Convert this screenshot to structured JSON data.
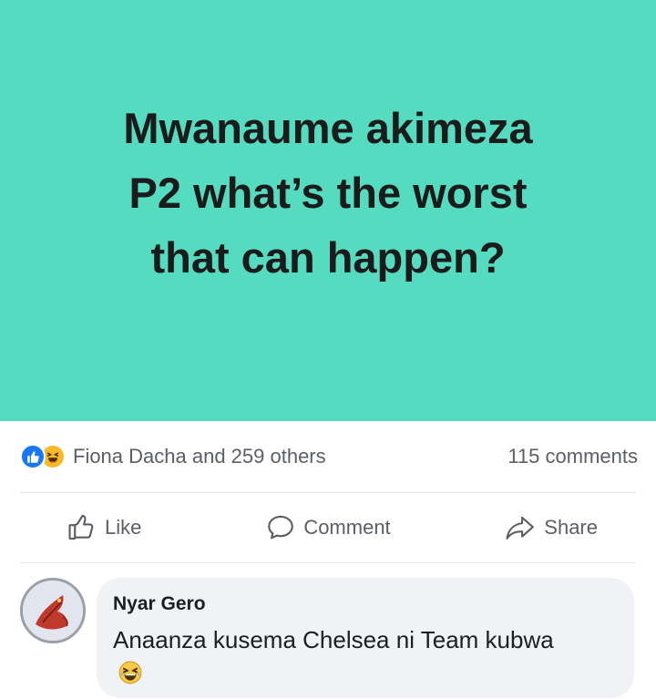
{
  "post": {
    "card_text": "Mwanaume akimeza\nP2 what’s the worst\nthat can happen?",
    "card_bg_color": "#55dcc0",
    "reactions": {
      "icons": [
        "like-icon",
        "haha-icon"
      ],
      "summary": "Fiona Dacha and 259 others",
      "comments_count": "115 comments"
    },
    "actions": {
      "like_label": "Like",
      "comment_label": "Comment",
      "share_label": "Share"
    }
  },
  "comment": {
    "author": "Nyar Gero",
    "text": "Anaanza kusema Chelsea ni Team kubwa",
    "emoji": "laughing-face-icon"
  },
  "colors": {
    "like_blue": "#1877f2",
    "haha_yellow": "#f7b928",
    "meta_gray": "#5b5e63"
  }
}
